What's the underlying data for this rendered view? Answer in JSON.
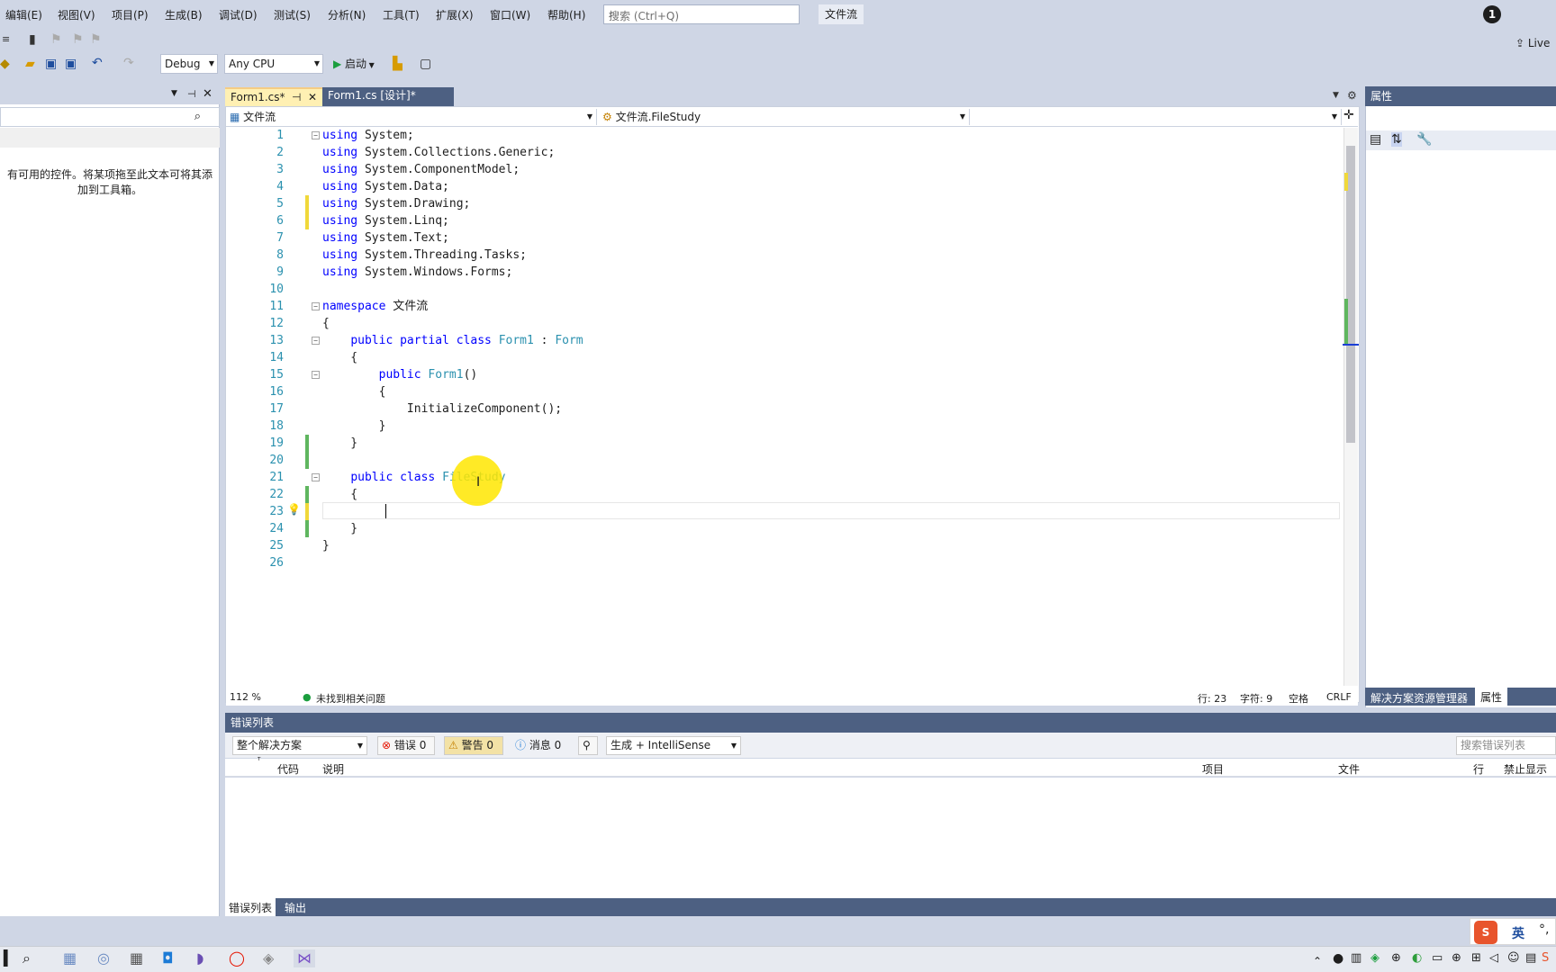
{
  "menu": [
    "编辑(E)",
    "视图(V)",
    "项目(P)",
    "生成(B)",
    "调试(D)",
    "测试(S)",
    "分析(N)",
    "工具(T)",
    "扩展(X)",
    "窗口(W)",
    "帮助(H)"
  ],
  "search": {
    "placeholder": "搜索 (Ctrl+Q)"
  },
  "solution_title": "文件流",
  "notification_count": "1",
  "live_share": "Live",
  "toolbar": {
    "config": "Debug",
    "platform": "Any CPU",
    "start": "启动"
  },
  "toolbox": {
    "empty_text_1": "有可用的控件。将某项拖至此文本可将其添",
    "empty_text_2": "加到工具箱。"
  },
  "tabs": [
    {
      "label": "Form1.cs*",
      "pin": "⊣",
      "close": "✕"
    },
    {
      "label": "Form1.cs [设计]*"
    }
  ],
  "navbar": {
    "project": "文件流",
    "class": "文件流.FileStudy",
    "member": ""
  },
  "code_lines": [
    {
      "n": "1",
      "text": "using System;"
    },
    {
      "n": "2",
      "text": "using System.Collections.Generic;"
    },
    {
      "n": "3",
      "text": "using System.ComponentModel;"
    },
    {
      "n": "4",
      "text": "using System.Data;"
    },
    {
      "n": "5",
      "text": "using System.Drawing;"
    },
    {
      "n": "6",
      "text": "using System.Linq;"
    },
    {
      "n": "7",
      "text": "using System.Text;"
    },
    {
      "n": "8",
      "text": "using System.Threading.Tasks;"
    },
    {
      "n": "9",
      "text": "using System.Windows.Forms;"
    },
    {
      "n": "10",
      "text": ""
    },
    {
      "n": "11",
      "text": "namespace 文件流"
    },
    {
      "n": "12",
      "text": "{"
    },
    {
      "n": "13",
      "text": "    public partial class Form1 : Form"
    },
    {
      "n": "14",
      "text": "    {"
    },
    {
      "n": "15",
      "text": "        public Form1()"
    },
    {
      "n": "16",
      "text": "        {"
    },
    {
      "n": "17",
      "text": "            InitializeComponent();"
    },
    {
      "n": "18",
      "text": "        }"
    },
    {
      "n": "19",
      "text": "    }"
    },
    {
      "n": "20",
      "text": ""
    },
    {
      "n": "21",
      "text": "    public class FileStudy"
    },
    {
      "n": "22",
      "text": "    {"
    },
    {
      "n": "23",
      "text": "        "
    },
    {
      "n": "24",
      "text": "    }"
    },
    {
      "n": "25",
      "text": "}"
    },
    {
      "n": "26",
      "text": ""
    }
  ],
  "editor_status": {
    "zoom": "112 %",
    "issues": "未找到相关问题",
    "line": "行: 23",
    "char": "字符: 9",
    "spacing": "空格",
    "eol": "CRLF"
  },
  "properties": {
    "title": "属性",
    "tab_solution": "解决方案资源管理器",
    "tab_props": "属性"
  },
  "error_list": {
    "title": "错误列表",
    "scope": "整个解决方案",
    "errors": "错误 0",
    "warnings": "警告 0",
    "messages": "消息 0",
    "build_filter": "生成 + IntelliSense",
    "search_placeholder": "搜索错误列表",
    "columns": {
      "code": "代码",
      "desc": "说明",
      "project": "项目",
      "file": "文件",
      "line": "行",
      "suppress": "禁止显示状"
    },
    "tab_errors": "错误列表",
    "tab_output": "输出"
  },
  "ime": {
    "lang": "英"
  }
}
